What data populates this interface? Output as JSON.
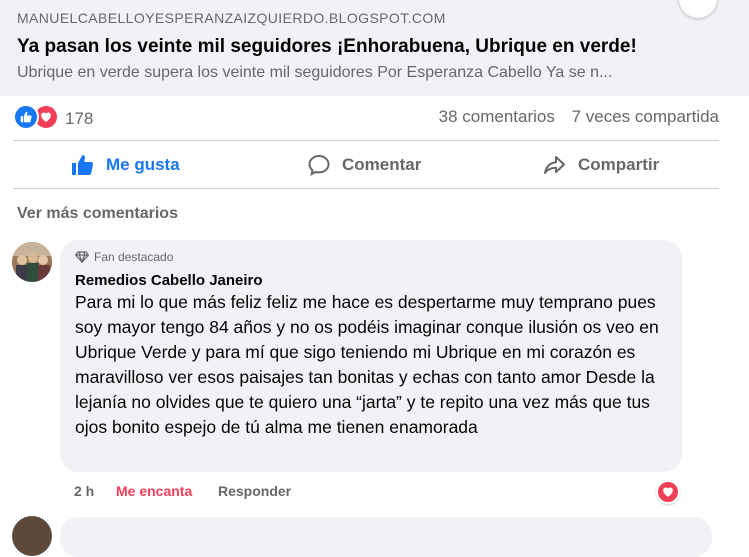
{
  "link_preview": {
    "domain": "MANUELCABELLOYESPERANZAIZQUIERDO.BLOGSPOT.COM",
    "title": "Ya pasan los veinte mil seguidores ¡Enhorabuena, Ubrique en verde!",
    "description": "Ubrique en verde supera los veinte mil seguidores Por Esperanza Cabello Ya se n..."
  },
  "stats": {
    "reaction_count": "178",
    "comments": "38 comentarios",
    "shares": "7 veces compartida",
    "reaction_icons": [
      "like-icon",
      "love-icon"
    ]
  },
  "actions": {
    "like": "Me gusta",
    "comment": "Comentar",
    "share": "Compartir"
  },
  "see_more_comments": "Ver más comentarios",
  "comment": {
    "badge": "Fan destacado",
    "author": "Remedios Cabello Janeiro",
    "text": "Para mi lo que más feliz feliz me hace es despertarme muy temprano pues soy mayor tengo 84 años y no os podéis imaginar conque ilusión os veo en Ubrique Verde y para mí que sigo teniendo mi Ubrique en mi corazón es maravilloso ver esos paisajes tan bonitas y echas con tanto amor Desde la lejanía no olvides que te quiero una “jarta” y te repito una vez más que tus ojos bonito espejo de tú alma me tienen enamorada",
    "time": "2 h",
    "reaction_label": "Me encanta",
    "reply_label": "Responder"
  },
  "colors": {
    "accent": "#1877f2",
    "love": "#f33e58",
    "muted": "#65676b",
    "bubble": "#f0f2f5"
  }
}
